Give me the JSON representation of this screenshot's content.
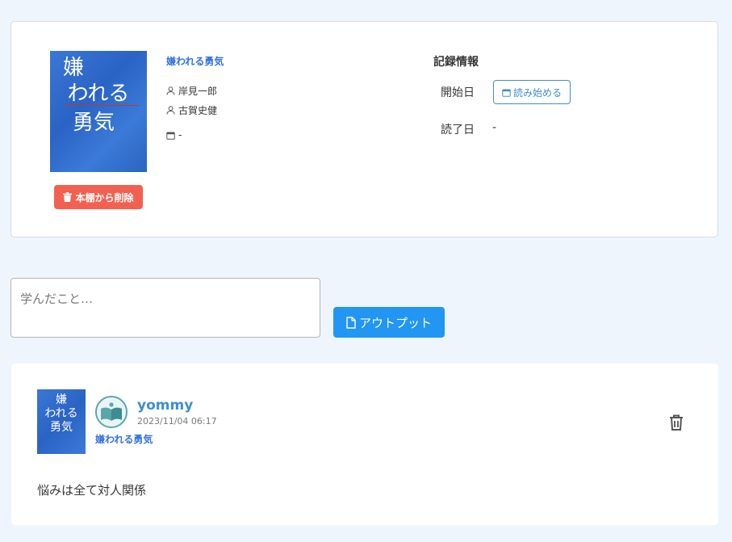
{
  "book": {
    "cover_lines": [
      "嫌",
      "われる",
      "勇気"
    ],
    "title": "嫌われる勇気",
    "authors": [
      "岸見一郎",
      "古賀史健"
    ],
    "date": "-",
    "delete_label": "本棚から削除"
  },
  "record": {
    "heading": "記録情報",
    "start_label": "開始日",
    "start_button": "読み始める",
    "end_label": "読了日",
    "end_value": "-"
  },
  "output": {
    "placeholder": "学んだこと…",
    "button_label": "アウトプット"
  },
  "post": {
    "username": "yommy",
    "timestamp": "2023/11/04 06:17",
    "book_title": "嫌われる勇気",
    "body": "悩みは全て対人関係"
  },
  "colors": {
    "accent": "#3e8ed0",
    "danger": "#f26150",
    "primary": "#2196f3",
    "background": "#eef5fd"
  },
  "icons": {
    "author": "user-icon",
    "date": "calendar-icon",
    "delete": "trash-icon",
    "output": "document-icon"
  }
}
